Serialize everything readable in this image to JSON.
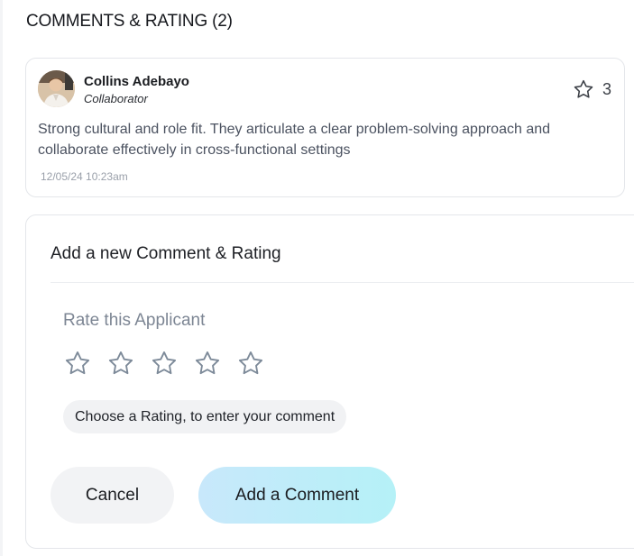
{
  "section": {
    "title": "COMMENTS & RATING (2)"
  },
  "comment": {
    "author_name": "Collins Adebayo",
    "author_role": "Collaborator",
    "rating": "3",
    "text": "Strong cultural and role fit. They articulate a clear problem-solving approach and collaborate effectively in cross-functional settings",
    "timestamp": "12/05/24 10:23am",
    "avatar_icon": "avatar-photo",
    "rating_icon": "star-outline-icon"
  },
  "form": {
    "heading": "Add a new Comment & Rating",
    "rate_label": "Rate this Applicant",
    "star_count": 5,
    "selected_rating": 0,
    "hint": "Choose a Rating, to enter your comment",
    "cancel_label": "Cancel",
    "submit_label": "Add a Comment"
  },
  "colors": {
    "star_stroke": "#7d8a99",
    "submit_gradient_start": "#c8e8fb",
    "submit_gradient_end": "#b5f1f7"
  }
}
